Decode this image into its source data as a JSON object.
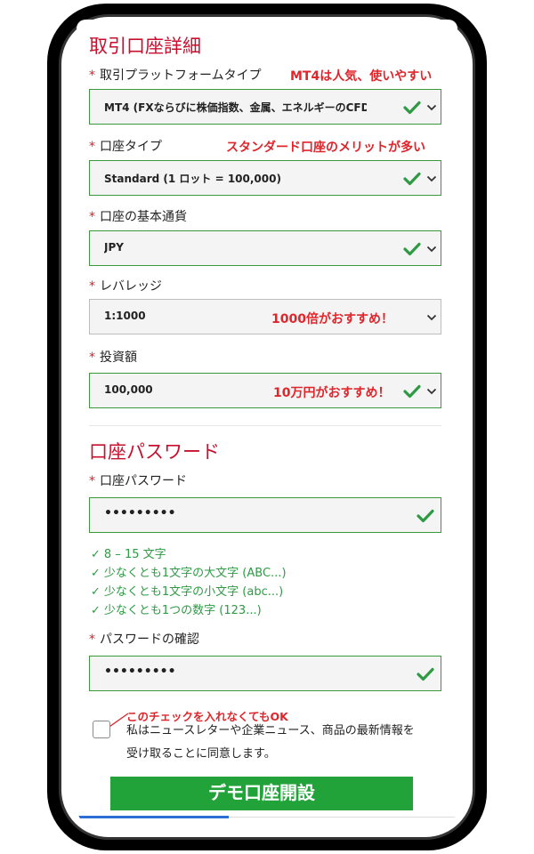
{
  "sections": {
    "account_details_title": "取引口座詳細",
    "password_title": "口座パスワード"
  },
  "fields": [
    {
      "label": "取引プラットフォームタイプ",
      "value": "MT4 (FXならびに株価指数、金属、エネルギーのCFD",
      "annotation": "MT4は人気、使いやすい",
      "valid": true
    },
    {
      "label": "口座タイプ",
      "value": "Standard (1 ロット = 100,000)",
      "annotation": "スタンダード口座のメリットが多い",
      "valid": true
    },
    {
      "label": "口座の基本通貨",
      "value": "JPY",
      "annotation": "",
      "valid": true
    },
    {
      "label": "レバレッジ",
      "value": "1:1000",
      "annotation": "1000倍がおすすめ！",
      "valid": false
    },
    {
      "label": "投資額",
      "value": "100,000",
      "annotation": "10万円がおすすめ！",
      "valid": true
    }
  ],
  "required_mark": "*",
  "password": {
    "label": "口座パスワード",
    "value": "•••••••••",
    "rules": [
      "8 – 15 文字",
      "少なくとも1文字の大文字 (ABC...)",
      "少なくとも1文字の小文字 (abc...)",
      "少なくとも1つの数字 (123...)"
    ],
    "rule_tick": "✓",
    "confirm_label": "パスワードの確認",
    "confirm_value": "•••••••••"
  },
  "consent": {
    "annotation": "このチェックを入れなくてもOK",
    "line1": "私はニュースレターや企業ニュース、商品の最新情報を",
    "line2": "受け取ることに同意します。",
    "checked": false
  },
  "submit_label": "デモ口座開設",
  "colors": {
    "section_title": "#c8102e",
    "annotation": "#e0252b",
    "valid_border": "#3a9a3a",
    "check": "#2e9a44",
    "cta": "#22a33a",
    "progress": "#2b6fd6"
  },
  "icons": {
    "valid": "check-icon",
    "dropdown": "chevron-down-icon",
    "annotation_pointer": "arrow-icon"
  }
}
